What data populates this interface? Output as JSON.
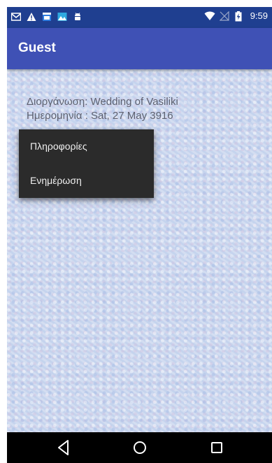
{
  "status_bar": {
    "time": "9:59",
    "left_icons": [
      "gmail-icon",
      "warning-icon",
      "calendar-icon",
      "photos-icon",
      "android-debug-icon"
    ],
    "right_icons": [
      "wifi-icon",
      "no-signal-icon",
      "battery-charging-icon"
    ]
  },
  "app_bar": {
    "title": "Guest",
    "color": "#3f51b5",
    "status_color": "#1f3f90"
  },
  "event": {
    "organization_line": "Διοργάνωση: Wedding of Vasiliki",
    "date_line": "Ημερομηνία : Sat, 27 May 3916"
  },
  "popup_menu": {
    "items": [
      {
        "label": "Πληροφορίες"
      },
      {
        "label": "Ενημέρωση"
      }
    ]
  },
  "nav_bar": {
    "buttons": [
      "back-icon",
      "home-icon",
      "recents-icon"
    ]
  }
}
